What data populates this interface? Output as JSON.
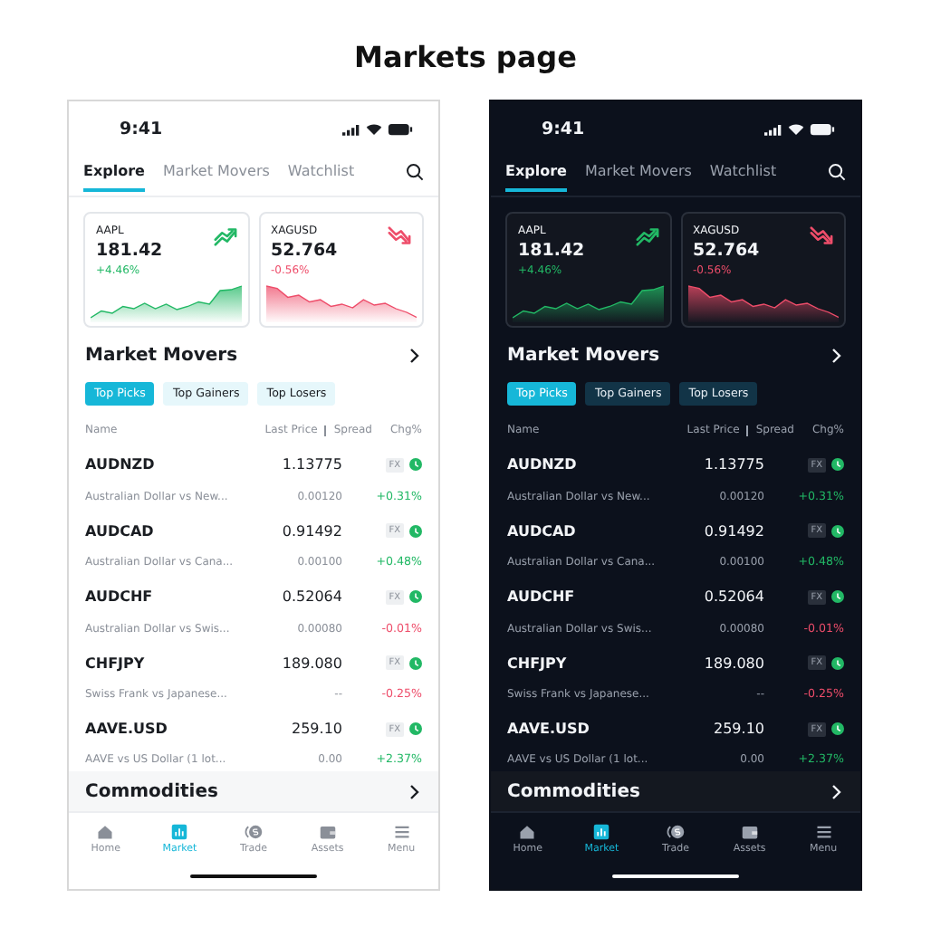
{
  "title": "Markets page",
  "screens": [
    {
      "dark": false,
      "time": "9:41",
      "tabs": [
        {
          "label": "Explore",
          "selected": true
        },
        {
          "label": "Market Movers",
          "selected": false
        },
        {
          "label": "Watchlist",
          "selected": false
        }
      ],
      "cards": [
        {
          "symbol": "AAPL",
          "price": "181.42",
          "change": "+4.46%",
          "rising": true
        },
        {
          "symbol": "XAGUSD",
          "price": "52.764",
          "change": "-0.56%",
          "rising": false
        }
      ],
      "section": "Market Movers",
      "chips": [
        {
          "label": "Top Picks",
          "selected": true
        },
        {
          "label": "Top Gainers",
          "selected": false
        },
        {
          "label": "Top Losers",
          "selected": false
        }
      ],
      "columns": {
        "name": "Name",
        "price": "Last Price",
        "spread": "Spread",
        "change": "Chg%"
      },
      "rows": [
        {
          "symbol": "AUDNZD",
          "name": "Australian Dollar vs New...",
          "price": "1.13775",
          "spread": "0.00120",
          "badge": "FX",
          "change": "+0.31%",
          "color": "#22b865"
        },
        {
          "symbol": "AUDCAD",
          "name": "Australian Dollar vs Cana...",
          "price": "0.91492",
          "spread": "0.00100",
          "badge": "FX",
          "change": "+0.48%",
          "color": "#22b865"
        },
        {
          "symbol": "AUDCHF",
          "name": "Australian Dollar vs Swis...",
          "price": "0.52064",
          "spread": "0.00080",
          "badge": "FX",
          "change": "-0.01%",
          "color": "#ee4d6a"
        },
        {
          "symbol": "CHFJPY",
          "name": "Swiss Frank vs Japanese...",
          "price": "189.080",
          "spread": "--",
          "badge": "FX",
          "change": "-0.25%",
          "color": "#ee4d6a"
        },
        {
          "symbol": "AAVE.USD",
          "name": "AAVE vs US Dollar (1 lot...",
          "price": "259.10",
          "spread": "0.00",
          "badge": "FX",
          "change": "+2.37%",
          "color": "#22b865"
        }
      ],
      "next_section": "Commodities",
      "nav": [
        {
          "label": "Home",
          "selected": false
        },
        {
          "label": "Market",
          "selected": true
        },
        {
          "label": "Trade",
          "selected": false
        },
        {
          "label": "Assets",
          "selected": false
        },
        {
          "label": "Menu",
          "selected": false
        }
      ]
    },
    {
      "dark": true,
      "time": "9:41",
      "tabs": [
        {
          "label": "Explore",
          "selected": true
        },
        {
          "label": "Market Movers",
          "selected": false
        },
        {
          "label": "Watchlist",
          "selected": false
        }
      ],
      "cards": [
        {
          "symbol": "AAPL",
          "price": "181.42",
          "change": "+4.46%",
          "rising": true
        },
        {
          "symbol": "XAGUSD",
          "price": "52.764",
          "change": "-0.56%",
          "rising": false
        }
      ],
      "section": "Market Movers",
      "chips": [
        {
          "label": "Top Picks",
          "selected": true
        },
        {
          "label": "Top Gainers",
          "selected": false
        },
        {
          "label": "Top Losers",
          "selected": false
        }
      ],
      "columns": {
        "name": "Name",
        "price": "Last Price",
        "spread": "Spread",
        "change": "Chg%"
      },
      "rows": [
        {
          "symbol": "AUDNZD",
          "name": "Australian Dollar vs New...",
          "price": "1.13775",
          "spread": "0.00120",
          "badge": "FX",
          "change": "+0.31%",
          "color": "#22b865"
        },
        {
          "symbol": "AUDCAD",
          "name": "Australian Dollar vs Cana...",
          "price": "0.91492",
          "spread": "0.00100",
          "badge": "FX",
          "change": "+0.48%",
          "color": "#22b865"
        },
        {
          "symbol": "AUDCHF",
          "name": "Australian Dollar vs Swis...",
          "price": "0.52064",
          "spread": "0.00080",
          "badge": "FX",
          "change": "-0.01%",
          "color": "#ee4d6a"
        },
        {
          "symbol": "CHFJPY",
          "name": "Swiss Frank vs Japanese...",
          "price": "189.080",
          "spread": "--",
          "badge": "FX",
          "change": "-0.25%",
          "color": "#ee4d6a"
        },
        {
          "symbol": "AAVE.USD",
          "name": "AAVE vs US Dollar (1 lot...",
          "price": "259.10",
          "spread": "0.00",
          "badge": "FX",
          "change": "+2.37%",
          "color": "#22b865"
        }
      ],
      "next_section": "Commodities",
      "nav": [
        {
          "label": "Home",
          "selected": false
        },
        {
          "label": "Market",
          "selected": true
        },
        {
          "label": "Trade",
          "selected": false
        },
        {
          "label": "Assets",
          "selected": false
        },
        {
          "label": "Menu",
          "selected": false
        }
      ]
    }
  ]
}
